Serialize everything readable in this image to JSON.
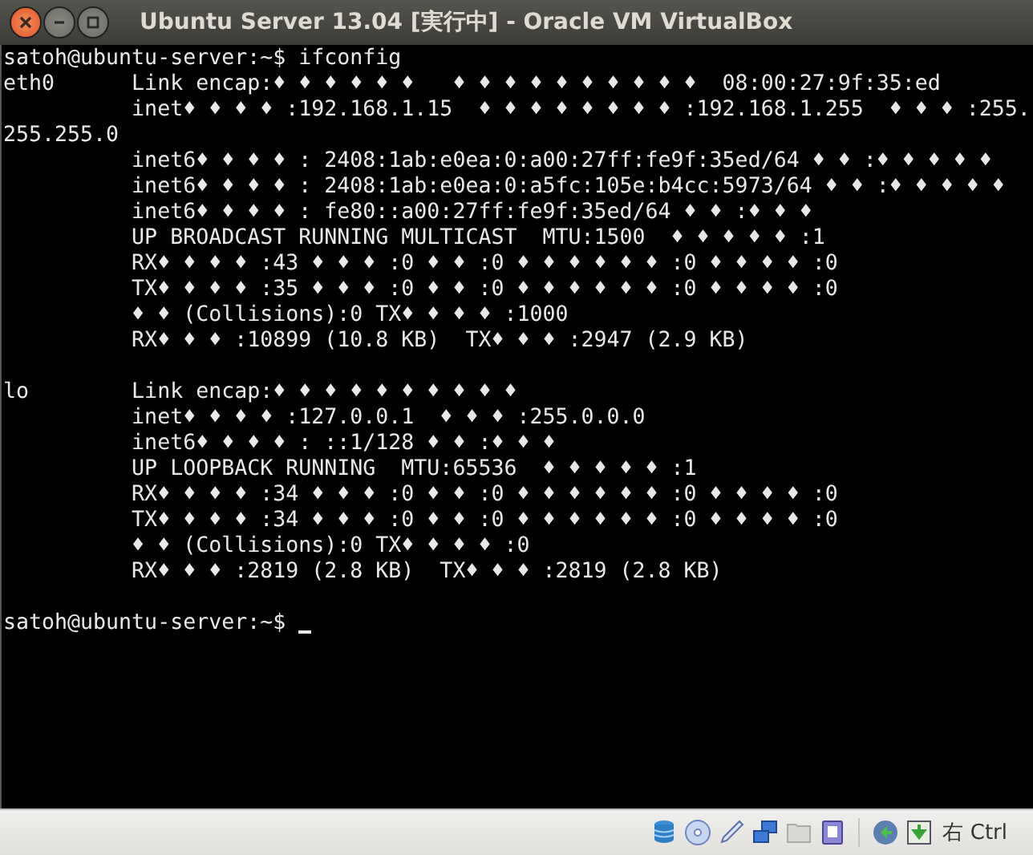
{
  "window": {
    "title": "Ubuntu Server 13.04 [実行中] - Oracle VM VirtualBox"
  },
  "terminal": {
    "command_line": "satoh@ubuntu-server:~$ ifconfig",
    "blocks": [
      [
        "eth0      Link encap:♦ ♦ ♦ ♦ ♦ ♦   ♦ ♦ ♦ ♦ ♦ ♦ ♦ ♦ ♦ ♦  08:00:27:9f:35:ed",
        "          inet♦ ♦ ♦ ♦ :192.168.1.15  ♦ ♦ ♦ ♦ ♦ ♦ ♦ ♦ :192.168.1.255  ♦ ♦ ♦ :255.",
        "255.255.0",
        "          inet6♦ ♦ ♦ ♦ : 2408:1ab:e0ea:0:a00:27ff:fe9f:35ed/64 ♦ ♦ :♦ ♦ ♦ ♦ ♦",
        "          inet6♦ ♦ ♦ ♦ : 2408:1ab:e0ea:0:a5fc:105e:b4cc:5973/64 ♦ ♦ :♦ ♦ ♦ ♦ ♦",
        "          inet6♦ ♦ ♦ ♦ : fe80::a00:27ff:fe9f:35ed/64 ♦ ♦ :♦ ♦ ♦",
        "          UP BROADCAST RUNNING MULTICAST  MTU:1500  ♦ ♦ ♦ ♦ ♦ :1",
        "          RX♦ ♦ ♦ ♦ :43 ♦ ♦ ♦ :0 ♦ ♦ :0 ♦ ♦ ♦ ♦ ♦ ♦ :0 ♦ ♦ ♦ ♦ :0",
        "          TX♦ ♦ ♦ ♦ :35 ♦ ♦ ♦ :0 ♦ ♦ :0 ♦ ♦ ♦ ♦ ♦ ♦ :0 ♦ ♦ ♦ ♦ :0",
        "          ♦ ♦ (Collisions):0 TX♦ ♦ ♦ ♦ :1000",
        "          RX♦ ♦ ♦ :10899 (10.8 KB)  TX♦ ♦ ♦ :2947 (2.9 KB)"
      ],
      [
        "lo        Link encap:♦ ♦ ♦ ♦ ♦ ♦ ♦ ♦ ♦ ♦",
        "          inet♦ ♦ ♦ ♦ :127.0.0.1  ♦ ♦ ♦ :255.0.0.0",
        "          inet6♦ ♦ ♦ ♦ : ::1/128 ♦ ♦ :♦ ♦ ♦",
        "          UP LOOPBACK RUNNING  MTU:65536  ♦ ♦ ♦ ♦ ♦ :1",
        "          RX♦ ♦ ♦ ♦ :34 ♦ ♦ ♦ :0 ♦ ♦ :0 ♦ ♦ ♦ ♦ ♦ ♦ :0 ♦ ♦ ♦ ♦ :0",
        "          TX♦ ♦ ♦ ♦ :34 ♦ ♦ ♦ :0 ♦ ♦ :0 ♦ ♦ ♦ ♦ ♦ ♦ :0 ♦ ♦ ♦ ♦ :0",
        "          ♦ ♦ (Collisions):0 TX♦ ♦ ♦ ♦ :0",
        "          RX♦ ♦ ♦ :2819 (2.8 KB)  TX♦ ♦ ♦ :2819 (2.8 KB)"
      ]
    ],
    "prompt": "satoh@ubuntu-server:~$ "
  },
  "status_bar": {
    "host_key": "右 Ctrl"
  }
}
